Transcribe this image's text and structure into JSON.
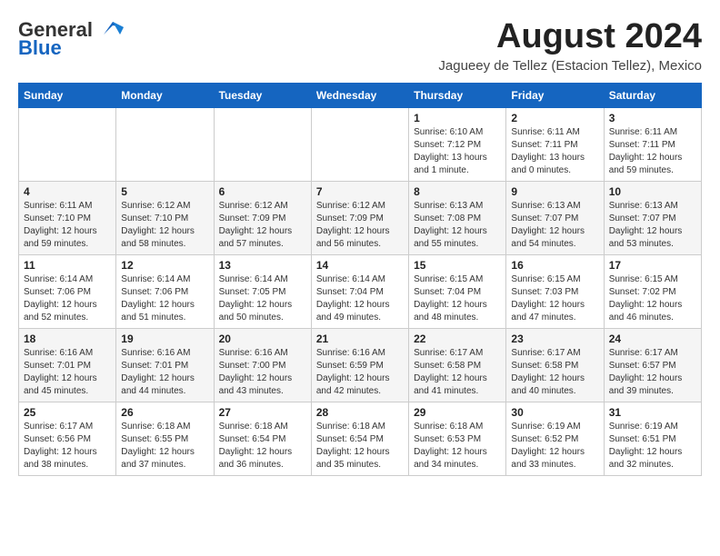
{
  "header": {
    "logo_general": "General",
    "logo_blue": "Blue",
    "month_title": "August 2024",
    "location": "Jagueey de Tellez (Estacion Tellez), Mexico"
  },
  "weekdays": [
    "Sunday",
    "Monday",
    "Tuesday",
    "Wednesday",
    "Thursday",
    "Friday",
    "Saturday"
  ],
  "weeks": [
    [
      {
        "day": "",
        "info": ""
      },
      {
        "day": "",
        "info": ""
      },
      {
        "day": "",
        "info": ""
      },
      {
        "day": "",
        "info": ""
      },
      {
        "day": "1",
        "info": "Sunrise: 6:10 AM\nSunset: 7:12 PM\nDaylight: 13 hours\nand 1 minute."
      },
      {
        "day": "2",
        "info": "Sunrise: 6:11 AM\nSunset: 7:11 PM\nDaylight: 13 hours\nand 0 minutes."
      },
      {
        "day": "3",
        "info": "Sunrise: 6:11 AM\nSunset: 7:11 PM\nDaylight: 12 hours\nand 59 minutes."
      }
    ],
    [
      {
        "day": "4",
        "info": "Sunrise: 6:11 AM\nSunset: 7:10 PM\nDaylight: 12 hours\nand 59 minutes."
      },
      {
        "day": "5",
        "info": "Sunrise: 6:12 AM\nSunset: 7:10 PM\nDaylight: 12 hours\nand 58 minutes."
      },
      {
        "day": "6",
        "info": "Sunrise: 6:12 AM\nSunset: 7:09 PM\nDaylight: 12 hours\nand 57 minutes."
      },
      {
        "day": "7",
        "info": "Sunrise: 6:12 AM\nSunset: 7:09 PM\nDaylight: 12 hours\nand 56 minutes."
      },
      {
        "day": "8",
        "info": "Sunrise: 6:13 AM\nSunset: 7:08 PM\nDaylight: 12 hours\nand 55 minutes."
      },
      {
        "day": "9",
        "info": "Sunrise: 6:13 AM\nSunset: 7:07 PM\nDaylight: 12 hours\nand 54 minutes."
      },
      {
        "day": "10",
        "info": "Sunrise: 6:13 AM\nSunset: 7:07 PM\nDaylight: 12 hours\nand 53 minutes."
      }
    ],
    [
      {
        "day": "11",
        "info": "Sunrise: 6:14 AM\nSunset: 7:06 PM\nDaylight: 12 hours\nand 52 minutes."
      },
      {
        "day": "12",
        "info": "Sunrise: 6:14 AM\nSunset: 7:06 PM\nDaylight: 12 hours\nand 51 minutes."
      },
      {
        "day": "13",
        "info": "Sunrise: 6:14 AM\nSunset: 7:05 PM\nDaylight: 12 hours\nand 50 minutes."
      },
      {
        "day": "14",
        "info": "Sunrise: 6:14 AM\nSunset: 7:04 PM\nDaylight: 12 hours\nand 49 minutes."
      },
      {
        "day": "15",
        "info": "Sunrise: 6:15 AM\nSunset: 7:04 PM\nDaylight: 12 hours\nand 48 minutes."
      },
      {
        "day": "16",
        "info": "Sunrise: 6:15 AM\nSunset: 7:03 PM\nDaylight: 12 hours\nand 47 minutes."
      },
      {
        "day": "17",
        "info": "Sunrise: 6:15 AM\nSunset: 7:02 PM\nDaylight: 12 hours\nand 46 minutes."
      }
    ],
    [
      {
        "day": "18",
        "info": "Sunrise: 6:16 AM\nSunset: 7:01 PM\nDaylight: 12 hours\nand 45 minutes."
      },
      {
        "day": "19",
        "info": "Sunrise: 6:16 AM\nSunset: 7:01 PM\nDaylight: 12 hours\nand 44 minutes."
      },
      {
        "day": "20",
        "info": "Sunrise: 6:16 AM\nSunset: 7:00 PM\nDaylight: 12 hours\nand 43 minutes."
      },
      {
        "day": "21",
        "info": "Sunrise: 6:16 AM\nSunset: 6:59 PM\nDaylight: 12 hours\nand 42 minutes."
      },
      {
        "day": "22",
        "info": "Sunrise: 6:17 AM\nSunset: 6:58 PM\nDaylight: 12 hours\nand 41 minutes."
      },
      {
        "day": "23",
        "info": "Sunrise: 6:17 AM\nSunset: 6:58 PM\nDaylight: 12 hours\nand 40 minutes."
      },
      {
        "day": "24",
        "info": "Sunrise: 6:17 AM\nSunset: 6:57 PM\nDaylight: 12 hours\nand 39 minutes."
      }
    ],
    [
      {
        "day": "25",
        "info": "Sunrise: 6:17 AM\nSunset: 6:56 PM\nDaylight: 12 hours\nand 38 minutes."
      },
      {
        "day": "26",
        "info": "Sunrise: 6:18 AM\nSunset: 6:55 PM\nDaylight: 12 hours\nand 37 minutes."
      },
      {
        "day": "27",
        "info": "Sunrise: 6:18 AM\nSunset: 6:54 PM\nDaylight: 12 hours\nand 36 minutes."
      },
      {
        "day": "28",
        "info": "Sunrise: 6:18 AM\nSunset: 6:54 PM\nDaylight: 12 hours\nand 35 minutes."
      },
      {
        "day": "29",
        "info": "Sunrise: 6:18 AM\nSunset: 6:53 PM\nDaylight: 12 hours\nand 34 minutes."
      },
      {
        "day": "30",
        "info": "Sunrise: 6:19 AM\nSunset: 6:52 PM\nDaylight: 12 hours\nand 33 minutes."
      },
      {
        "day": "31",
        "info": "Sunrise: 6:19 AM\nSunset: 6:51 PM\nDaylight: 12 hours\nand 32 minutes."
      }
    ]
  ]
}
